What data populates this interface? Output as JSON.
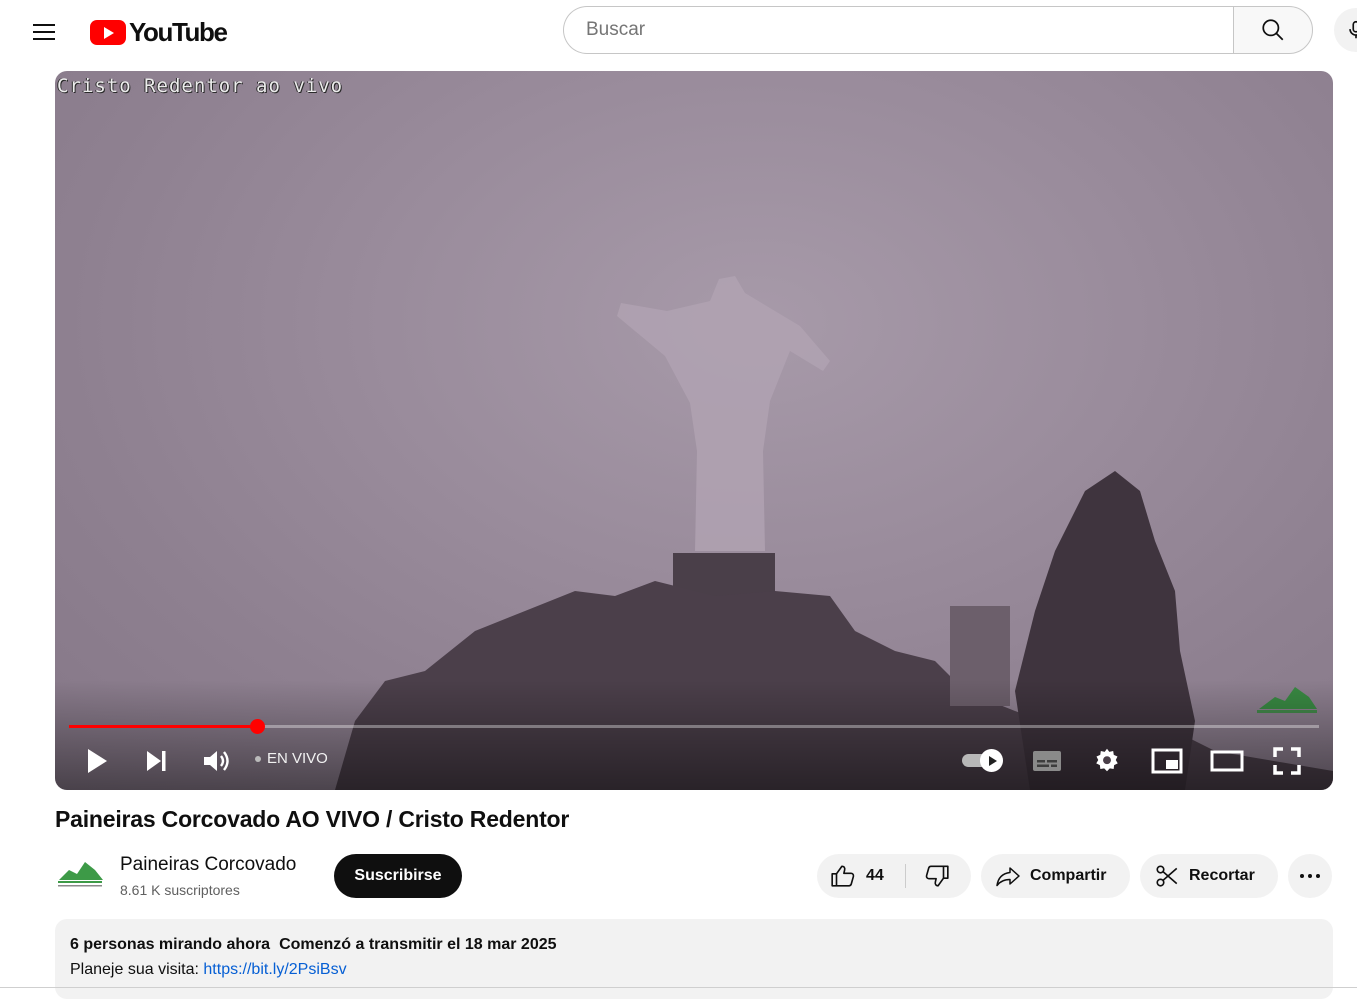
{
  "masthead": {
    "logo_text": "YouTube",
    "search_placeholder": "Buscar"
  },
  "player": {
    "overlay_text": "Cristo Redentor ao vivo",
    "live_label": "EN VIVO",
    "progress": 0.15,
    "progress_color": "#ff0000"
  },
  "video": {
    "title": "Paineiras Corcovado AO VIVO / Cristo Redentor"
  },
  "channel": {
    "name": "Paineiras Corcovado",
    "subscribers": "8.61 K suscriptores",
    "subscribe_label": "Suscribirse"
  },
  "actions": {
    "like_count": "44",
    "share_label": "Compartir",
    "clip_label": "Recortar"
  },
  "description": {
    "viewers": "6 personas mirando ahora",
    "started": "Comenzó a transmitir el 18 mar 2025",
    "line_prefix": "Planeje sua visita: ",
    "link": "https://bit.ly/2PsiBsv"
  },
  "icons": [
    "menu-icon",
    "youtube-logo-icon",
    "search-icon",
    "microphone-icon",
    "play-icon",
    "next-icon",
    "volume-icon",
    "autoplay-toggle-icon",
    "subtitles-icon",
    "settings-icon",
    "miniplayer-icon",
    "theater-icon",
    "fullscreen-icon",
    "like-icon",
    "dislike-icon",
    "share-icon",
    "scissors-icon",
    "more-icon"
  ]
}
